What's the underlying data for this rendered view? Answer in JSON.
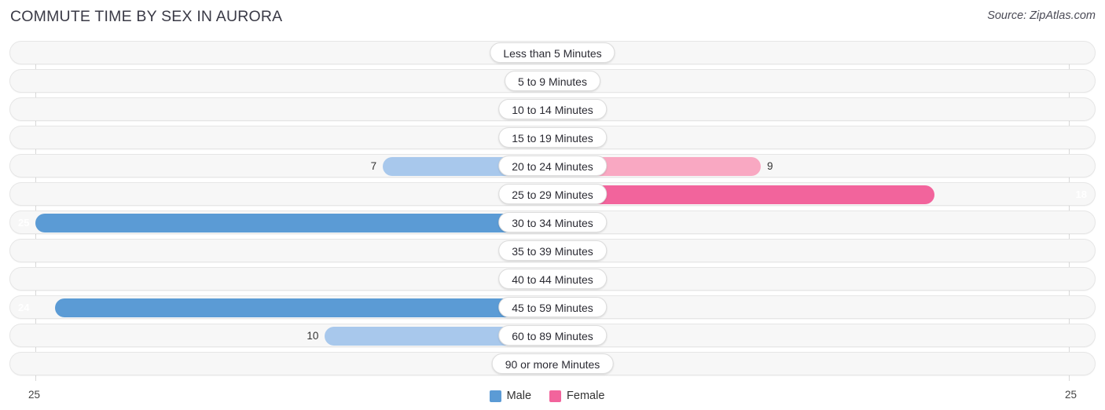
{
  "header": {
    "title": "COMMUTE TIME BY SEX IN AURORA",
    "source": "Source: ZipAtlas.com"
  },
  "axis": {
    "left_label": "25",
    "right_label": "25"
  },
  "legend": {
    "male_label": "Male",
    "female_label": "Female",
    "male_color": "#5b9bd5",
    "female_color": "#f2649c"
  },
  "colors": {
    "male_light": "#a8c8ec",
    "male_strong": "#5b9bd5",
    "female_light": "#f9a8c2",
    "female_strong": "#f2649c",
    "row_background": "#f7f7f7",
    "pill_background": "#ffffff"
  },
  "chart_data": {
    "type": "bar",
    "orientation": "horizontal-diverging",
    "title": "COMMUTE TIME BY SEX IN AURORA",
    "xlabel": "",
    "ylabel": "",
    "axis_max": 25,
    "xlim": [
      25,
      25
    ],
    "grid": false,
    "legend_position": "bottom-center",
    "categories": [
      "Less than 5 Minutes",
      "5 to 9 Minutes",
      "10 to 14 Minutes",
      "15 to 19 Minutes",
      "20 to 24 Minutes",
      "25 to 29 Minutes",
      "30 to 34 Minutes",
      "35 to 39 Minutes",
      "40 to 44 Minutes",
      "45 to 59 Minutes",
      "60 to 89 Minutes",
      "90 or more Minutes"
    ],
    "series": [
      {
        "name": "Male",
        "values": [
          0,
          0,
          0,
          0,
          7,
          0,
          25,
          0,
          0,
          24,
          10,
          0
        ]
      },
      {
        "name": "Female",
        "values": [
          0,
          0,
          0,
          0,
          9,
          18,
          0,
          0,
          0,
          0,
          0,
          0
        ]
      }
    ]
  },
  "rows": [
    {
      "label": "Less than 5 Minutes",
      "male": "0",
      "female": "0"
    },
    {
      "label": "5 to 9 Minutes",
      "male": "0",
      "female": "0"
    },
    {
      "label": "10 to 14 Minutes",
      "male": "0",
      "female": "0"
    },
    {
      "label": "15 to 19 Minutes",
      "male": "0",
      "female": "0"
    },
    {
      "label": "20 to 24 Minutes",
      "male": "7",
      "female": "9"
    },
    {
      "label": "25 to 29 Minutes",
      "male": "0",
      "female": "18"
    },
    {
      "label": "30 to 34 Minutes",
      "male": "25",
      "female": "0"
    },
    {
      "label": "35 to 39 Minutes",
      "male": "0",
      "female": "0"
    },
    {
      "label": "40 to 44 Minutes",
      "male": "0",
      "female": "0"
    },
    {
      "label": "45 to 59 Minutes",
      "male": "24",
      "female": "0"
    },
    {
      "label": "60 to 89 Minutes",
      "male": "10",
      "female": "0"
    },
    {
      "label": "90 or more Minutes",
      "male": "0",
      "female": "0"
    }
  ]
}
